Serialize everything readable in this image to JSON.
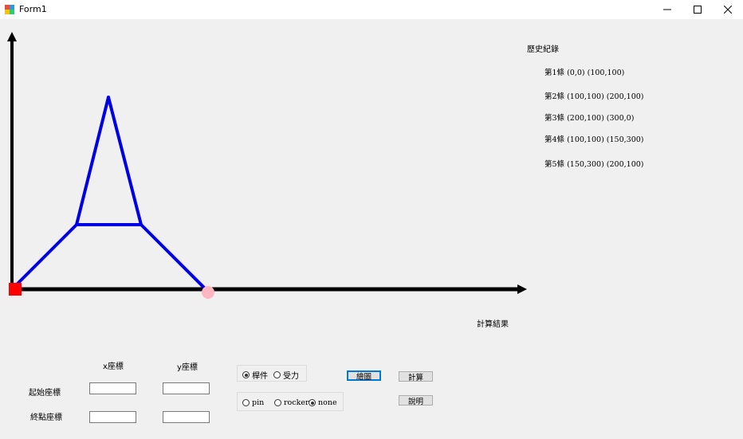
{
  "window": {
    "title": "Form1"
  },
  "colors": {
    "axis": "#000000",
    "member": "#0000e6",
    "pin_support": "#ff0000",
    "roller_support": "#ffb6c1"
  },
  "history": {
    "title": "歷史紀錄",
    "items": [
      {
        "label": "第1條",
        "coords": "(0,0) (100,100)"
      },
      {
        "label": "第2條",
        "coords": "(100,100) (200,100)"
      },
      {
        "label": "第3條",
        "coords": "(200,100) (300,0)"
      },
      {
        "label": "第4條",
        "coords": "(100,100) (150,300)"
      },
      {
        "label": "第5條",
        "coords": "(150,300) (200,100)"
      }
    ]
  },
  "result": {
    "title": "計算結果"
  },
  "inputs": {
    "x_header": "x座標",
    "y_header": "y座標",
    "start_label": "起始座標",
    "end_label": "終點座標",
    "start_x": "",
    "start_y": "",
    "end_x": "",
    "end_y": ""
  },
  "mode_group": {
    "options": [
      "桿件",
      "受力"
    ],
    "selected": "桿件"
  },
  "support_group": {
    "options": [
      "pin",
      "rocker",
      "none"
    ],
    "selected": "none"
  },
  "buttons": {
    "draw": "繪圖",
    "calculate": "計算",
    "help": "說明"
  }
}
